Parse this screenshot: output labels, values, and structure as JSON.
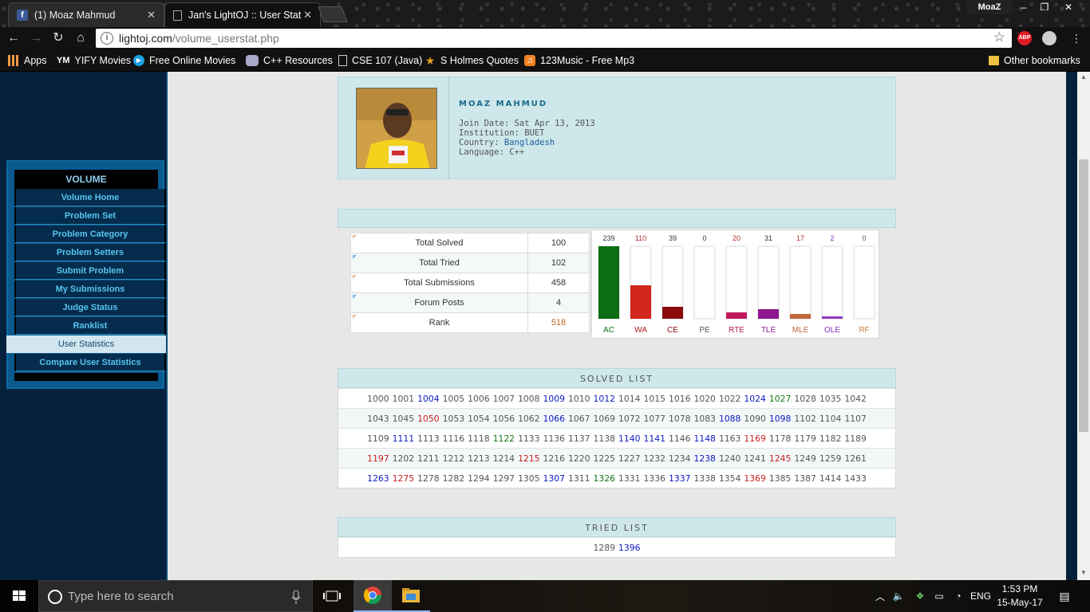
{
  "browser": {
    "tabs": [
      {
        "label": "(1) Moaz Mahmud",
        "icon": "facebook-icon"
      },
      {
        "label": "Jan's LightOJ :: User Stati",
        "icon": "page-icon"
      }
    ],
    "profile_name": "MoaZ",
    "url_host": "lightoj.com",
    "url_path": "/volume_userstat.php",
    "extensions": [
      "ABP"
    ]
  },
  "bookmarks": [
    {
      "label": "Apps",
      "icon": "apps-grid-icon"
    },
    {
      "label": "YIFY Movies",
      "icon": "yify-icon",
      "icon_text": "YM"
    },
    {
      "label": "Free Online Movies",
      "icon": "play-icon"
    },
    {
      "label": "C++ Resources",
      "icon": "controller-icon"
    },
    {
      "label": "CSE 107 (Java)",
      "icon": "document-icon"
    },
    {
      "label": "S Holmes Quotes",
      "icon": "star-icon"
    },
    {
      "label": "123Music - Free Mp3",
      "icon": "headphones-icon"
    },
    {
      "label": "Other bookmarks",
      "icon": "folder-icon"
    }
  ],
  "menu": {
    "title": "VOLUME",
    "items": [
      {
        "label": "Volume Home"
      },
      {
        "label": "Problem Set"
      },
      {
        "label": "Problem Category"
      },
      {
        "label": "Problem Setters"
      },
      {
        "label": "Submit Problem"
      },
      {
        "label": "My Submissions"
      },
      {
        "label": "Judge Status"
      },
      {
        "label": "Ranklist"
      },
      {
        "label": "User Statistics",
        "active": true
      },
      {
        "label": "Compare User Statistics"
      }
    ]
  },
  "profile": {
    "name": "MOAZ MAHMUD",
    "join_date_label": "Join Date:",
    "join_date": "Sat Apr 13, 2013",
    "institution_label": "Institution:",
    "institution": "BUET",
    "country_label": "Country:",
    "country": "Bangladesh",
    "language_label": "Language:",
    "language": "C++"
  },
  "stats": [
    {
      "label": "Total Solved",
      "value": "100"
    },
    {
      "label": "Total Tried",
      "value": "102"
    },
    {
      "label": "Total Submissions",
      "value": "458"
    },
    {
      "label": "Forum Posts",
      "value": "4"
    },
    {
      "label": "Rank",
      "value": "518"
    }
  ],
  "chart_data": {
    "type": "bar",
    "categories": [
      "AC",
      "WA",
      "CE",
      "PE",
      "RTE",
      "TLE",
      "MLE",
      "OLE",
      "RF"
    ],
    "values": [
      239,
      110,
      39,
      0,
      20,
      31,
      17,
      2,
      0
    ],
    "colors": [
      "#0b6e12",
      "#d0261e",
      "#8a0a0a",
      "#555555",
      "#c2185b",
      "#8e178e",
      "#c06a3a",
      "#8e3ab8",
      "#c8803c"
    ],
    "value_label_color": [
      "#333333",
      "#b03030",
      "#333333",
      "#333333",
      "#b03030",
      "#333333",
      "#b03030",
      "#7b2fb5",
      "#555555"
    ],
    "label_colors": [
      "#0b6e12",
      "#b01e1e",
      "#8a0a0a",
      "#555555",
      "#b01e4a",
      "#8e178e",
      "#c06a3a",
      "#7b2fb5",
      "#c8803c"
    ],
    "ylim": [
      0,
      239
    ]
  },
  "solved_list": {
    "title": "SOLVED LIST",
    "rows": [
      [
        [
          "1000",
          "g"
        ],
        [
          "1001",
          "g"
        ],
        [
          "1004",
          "b"
        ],
        [
          "1005",
          "g"
        ],
        [
          "1006",
          "g"
        ],
        [
          "1007",
          "g"
        ],
        [
          "1008",
          "g"
        ],
        [
          "1009",
          "b"
        ],
        [
          "1010",
          "g"
        ],
        [
          "1012",
          "b"
        ],
        [
          "1014",
          "g"
        ],
        [
          "1015",
          "g"
        ],
        [
          "1016",
          "g"
        ],
        [
          "1020",
          "g"
        ],
        [
          "1022",
          "g"
        ],
        [
          "1024",
          "b"
        ],
        [
          "1027",
          "gr"
        ],
        [
          "1028",
          "g"
        ],
        [
          "1035",
          "g"
        ],
        [
          "1042",
          "g"
        ]
      ],
      [
        [
          "1043",
          "g"
        ],
        [
          "1045",
          "g"
        ],
        [
          "1050",
          "r"
        ],
        [
          "1053",
          "g"
        ],
        [
          "1054",
          "g"
        ],
        [
          "1056",
          "g"
        ],
        [
          "1062",
          "g"
        ],
        [
          "1066",
          "b"
        ],
        [
          "1067",
          "g"
        ],
        [
          "1069",
          "g"
        ],
        [
          "1072",
          "g"
        ],
        [
          "1077",
          "g"
        ],
        [
          "1078",
          "g"
        ],
        [
          "1083",
          "g"
        ],
        [
          "1088",
          "b"
        ],
        [
          "1090",
          "g"
        ],
        [
          "1098",
          "b"
        ],
        [
          "1102",
          "g"
        ],
        [
          "1104",
          "g"
        ],
        [
          "1107",
          "g"
        ]
      ],
      [
        [
          "1109",
          "g"
        ],
        [
          "1111",
          "b"
        ],
        [
          "1113",
          "g"
        ],
        [
          "1116",
          "g"
        ],
        [
          "1118",
          "g"
        ],
        [
          "1122",
          "gr"
        ],
        [
          "1133",
          "g"
        ],
        [
          "1136",
          "g"
        ],
        [
          "1137",
          "g"
        ],
        [
          "1138",
          "g"
        ],
        [
          "1140",
          "b"
        ],
        [
          "1141",
          "b"
        ],
        [
          "1146",
          "g"
        ],
        [
          "1148",
          "b"
        ],
        [
          "1163",
          "g"
        ],
        [
          "1169",
          "r"
        ],
        [
          "1178",
          "g"
        ],
        [
          "1179",
          "g"
        ],
        [
          "1182",
          "g"
        ],
        [
          "1189",
          "g"
        ]
      ],
      [
        [
          "1197",
          "r"
        ],
        [
          "1202",
          "g"
        ],
        [
          "1211",
          "g"
        ],
        [
          "1212",
          "g"
        ],
        [
          "1213",
          "g"
        ],
        [
          "1214",
          "g"
        ],
        [
          "1215",
          "r"
        ],
        [
          "1216",
          "g"
        ],
        [
          "1220",
          "g"
        ],
        [
          "1225",
          "g"
        ],
        [
          "1227",
          "g"
        ],
        [
          "1232",
          "g"
        ],
        [
          "1234",
          "g"
        ],
        [
          "1238",
          "b"
        ],
        [
          "1240",
          "g"
        ],
        [
          "1241",
          "g"
        ],
        [
          "1245",
          "r"
        ],
        [
          "1249",
          "g"
        ],
        [
          "1259",
          "g"
        ],
        [
          "1261",
          "g"
        ]
      ],
      [
        [
          "1263",
          "b"
        ],
        [
          "1275",
          "r"
        ],
        [
          "1278",
          "g"
        ],
        [
          "1282",
          "g"
        ],
        [
          "1294",
          "g"
        ],
        [
          "1297",
          "g"
        ],
        [
          "1305",
          "g"
        ],
        [
          "1307",
          "b"
        ],
        [
          "1311",
          "g"
        ],
        [
          "1326",
          "gr"
        ],
        [
          "1331",
          "g"
        ],
        [
          "1336",
          "g"
        ],
        [
          "1337",
          "b"
        ],
        [
          "1338",
          "g"
        ],
        [
          "1354",
          "g"
        ],
        [
          "1369",
          "r"
        ],
        [
          "1385",
          "g"
        ],
        [
          "1387",
          "g"
        ],
        [
          "1414",
          "g"
        ],
        [
          "1433",
          "g"
        ]
      ]
    ]
  },
  "tried_list": {
    "title": "TRIED LIST",
    "rows": [
      [
        [
          "1289",
          "g"
        ],
        [
          "1396",
          "b"
        ]
      ]
    ]
  },
  "taskbar": {
    "search_placeholder": "Type here to search",
    "language": "ENG",
    "time": "1:53 PM",
    "date": "15-May-17"
  }
}
